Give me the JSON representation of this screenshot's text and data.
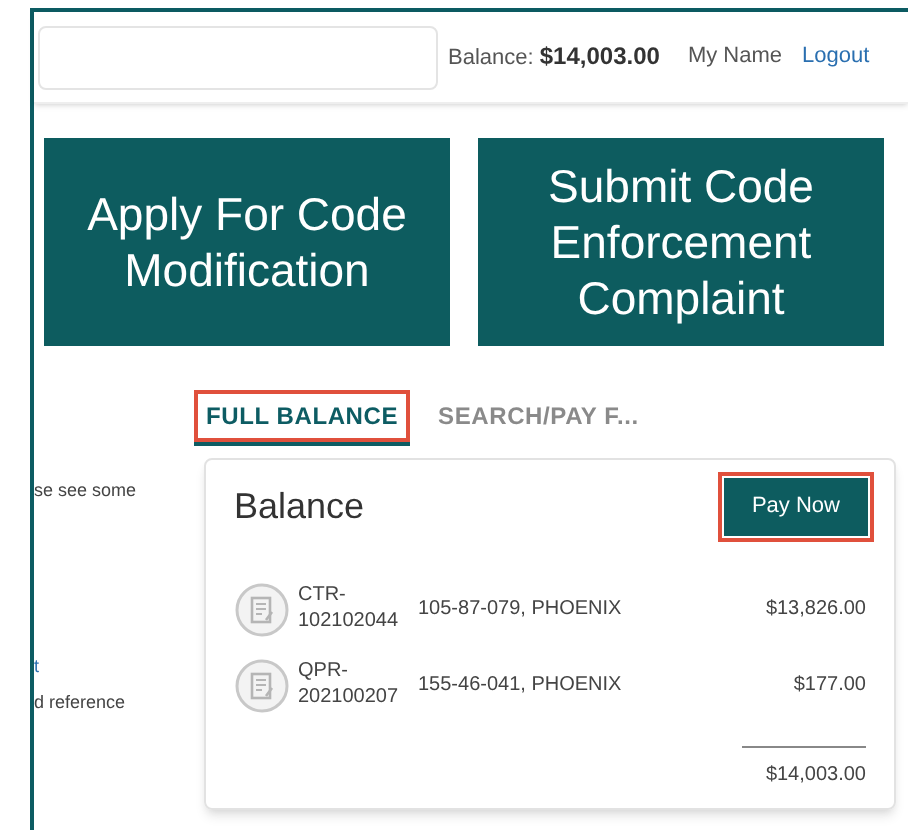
{
  "header": {
    "balance_label": "Balance:",
    "balance_value": "$14,003.00",
    "user_name": "My Name",
    "logout": "Logout"
  },
  "tiles": [
    "Apply For Code Modification",
    "Submit Code Enforcement Complaint"
  ],
  "tabs": [
    {
      "label": "FULL BALANCE",
      "selected": true,
      "highlighted": true
    },
    {
      "label": "SEARCH/PAY F...",
      "selected": false,
      "highlighted": false
    }
  ],
  "sidebar": [
    {
      "text": "se see some",
      "kind": "text"
    },
    {
      "text": "t",
      "kind": "link"
    },
    {
      "text": "d reference",
      "kind": "text"
    }
  ],
  "balance_card": {
    "title": "Balance",
    "pay_button": {
      "label": "Pay Now",
      "highlighted": true
    },
    "items": [
      {
        "id_prefix": "CTR-",
        "id_number": "102102044",
        "address": "105-87-079, PHOENIX",
        "amount": "$13,826.00"
      },
      {
        "id_prefix": "QPR-",
        "id_number": "202100207",
        "address": "155-46-041, PHOENIX",
        "amount": "$177.00"
      }
    ],
    "total": "$14,003.00"
  }
}
